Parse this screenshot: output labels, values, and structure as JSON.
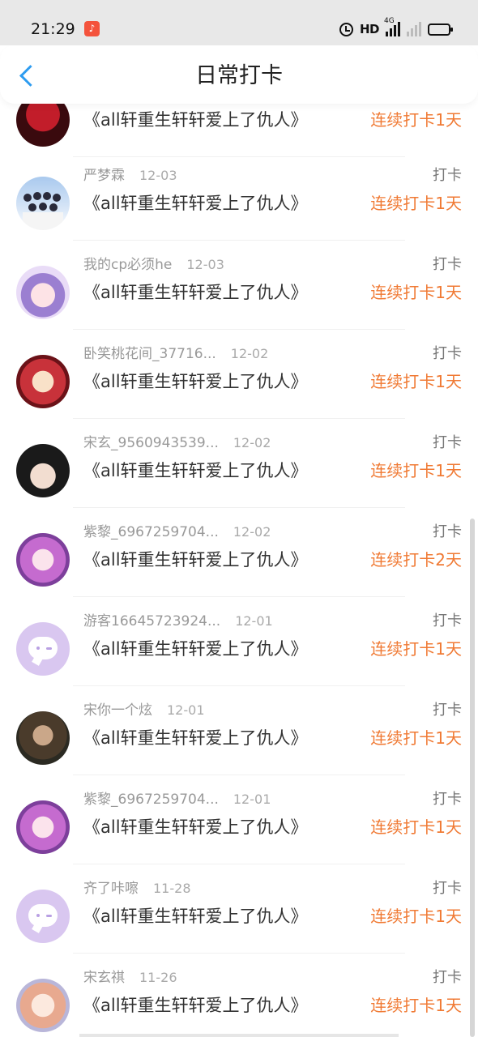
{
  "status_bar": {
    "time": "21:29",
    "hd_label": "HD",
    "network_label": "4G",
    "battery_color": "#f5c518"
  },
  "header": {
    "title": "日常打卡"
  },
  "list": [
    {
      "name": "",
      "date": "",
      "book": "《all轩重生轩轩爱上了仇人》",
      "action": "",
      "streak": "连续打卡1天"
    },
    {
      "name": "严梦霖",
      "date": "12-03",
      "book": "《all轩重生轩轩爱上了仇人》",
      "action": "打卡",
      "streak": "连续打卡1天"
    },
    {
      "name": "我的cp必须he",
      "date": "12-03",
      "book": "《all轩重生轩轩爱上了仇人》",
      "action": "打卡",
      "streak": "连续打卡1天"
    },
    {
      "name": "卧笑桃花间_37716...",
      "date": "12-02",
      "book": "《all轩重生轩轩爱上了仇人》",
      "action": "打卡",
      "streak": "连续打卡1天"
    },
    {
      "name": "宋玄_9560943539...",
      "date": "12-02",
      "book": "《all轩重生轩轩爱上了仇人》",
      "action": "打卡",
      "streak": "连续打卡1天"
    },
    {
      "name": "紫黎_6967259704...",
      "date": "12-02",
      "book": "《all轩重生轩轩爱上了仇人》",
      "action": "打卡",
      "streak": "连续打卡2天"
    },
    {
      "name": "游客16645723924...",
      "date": "12-01",
      "book": "《all轩重生轩轩爱上了仇人》",
      "action": "打卡",
      "streak": "连续打卡1天"
    },
    {
      "name": "宋你一个炫",
      "date": "12-01",
      "book": "《all轩重生轩轩爱上了仇人》",
      "action": "打卡",
      "streak": "连续打卡1天"
    },
    {
      "name": "紫黎_6967259704...",
      "date": "12-01",
      "book": "《all轩重生轩轩爱上了仇人》",
      "action": "打卡",
      "streak": "连续打卡1天"
    },
    {
      "name": "齐了咔嚓",
      "date": "11-28",
      "book": "《all轩重生轩轩爱上了仇人》",
      "action": "打卡",
      "streak": "连续打卡1天"
    },
    {
      "name": "宋玄祺",
      "date": "11-26",
      "book": "《all轩重生轩轩爱上了仇人》",
      "action": "打卡",
      "streak": "连续打卡1天"
    }
  ]
}
